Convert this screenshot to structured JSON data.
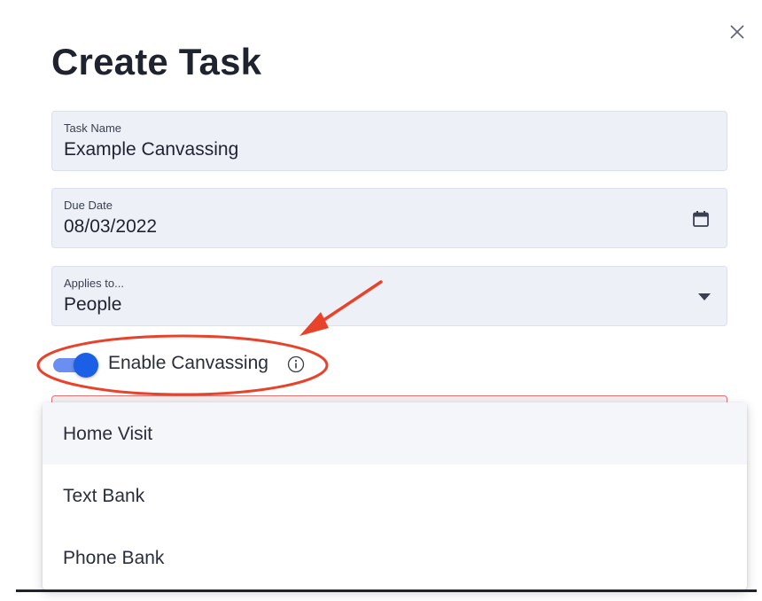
{
  "dialog": {
    "title": "Create Task",
    "close_icon": "close-icon"
  },
  "fields": {
    "task_name": {
      "label": "Task Name",
      "value": "Example Canvassing"
    },
    "due_date": {
      "label": "Due Date",
      "value": "08/03/2022",
      "icon": "calendar-icon"
    },
    "applies_to": {
      "label": "Applies to...",
      "value": "People",
      "icon": "caret-down-icon"
    }
  },
  "toggle": {
    "label": "Enable Canvassing",
    "checked": true,
    "info_icon": "info-icon"
  },
  "dropdown_menu": {
    "items": [
      {
        "label": "Home Visit",
        "highlighted": true
      },
      {
        "label": "Text Bank",
        "highlighted": false
      },
      {
        "label": "Phone Bank",
        "highlighted": false
      }
    ]
  },
  "annotation": {
    "color": "#e8432a",
    "shapes": [
      "arrow",
      "ellipse"
    ]
  },
  "colors": {
    "field_bg": "#eef0f8",
    "toggle_knob": "#1a5fe6",
    "toggle_track": "#6b8ff0",
    "error_border": "#e57373",
    "text": "#1f2330"
  }
}
